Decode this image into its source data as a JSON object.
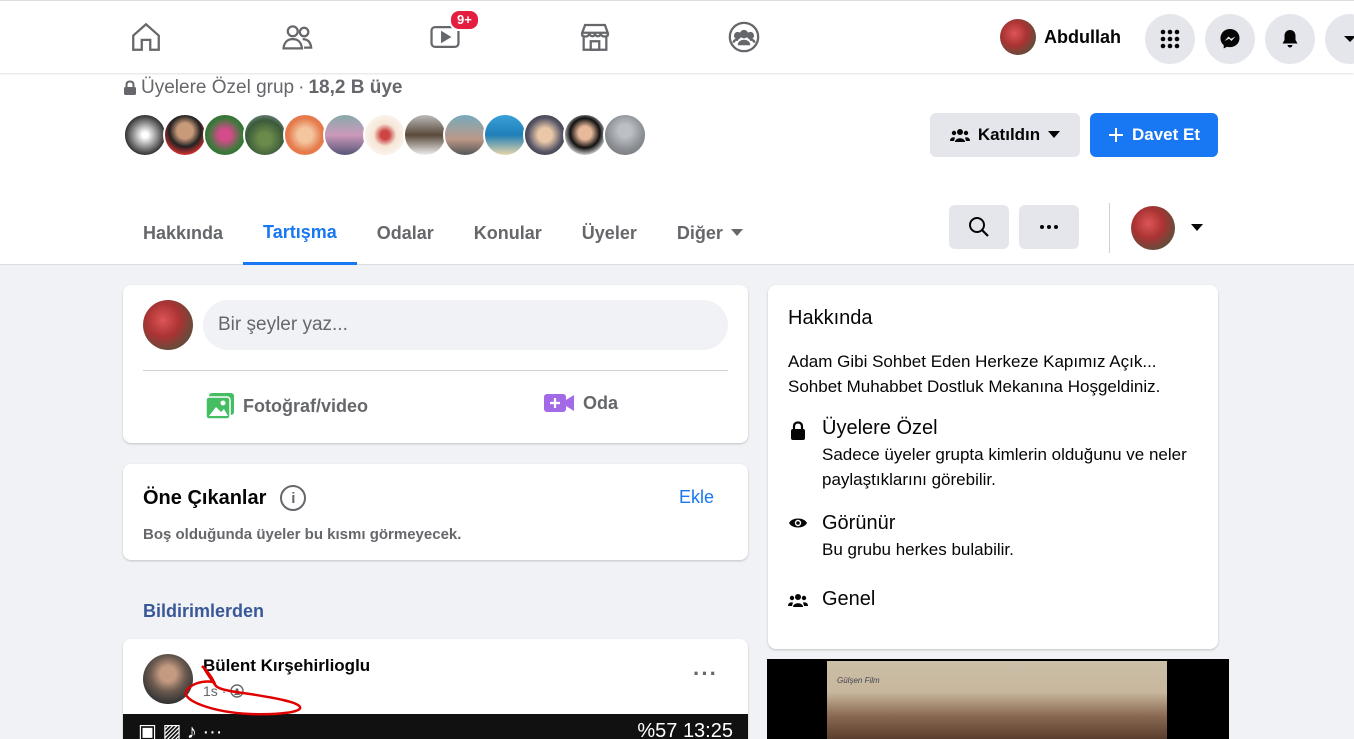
{
  "topbar": {
    "nav": [
      {
        "name": "home"
      },
      {
        "name": "friends"
      },
      {
        "name": "watch",
        "badge": "9+"
      },
      {
        "name": "marketplace"
      },
      {
        "name": "groups"
      }
    ],
    "profile_name": "Abdullah"
  },
  "group": {
    "privacy": "Üyelere Özel grup",
    "separator": "·",
    "member_count": "18,2 B üye",
    "joined_label": "Katıldın",
    "invite_label": "Davet Et",
    "tabs": [
      "Hakkında",
      "Tartışma",
      "Odalar",
      "Konular",
      "Üyeler",
      "Diğer"
    ],
    "active_tab": "Tartışma"
  },
  "composer": {
    "placeholder": "Bir şeyler yaz...",
    "photo_label": "Fotoğraf/video",
    "room_label": "Oda"
  },
  "featured": {
    "title": "Öne Çıkanlar",
    "add_label": "Ekle",
    "subtitle": "Boş olduğunda üyeler bu kısmı görmeyecek."
  },
  "feed": {
    "section_label": "Bildirimlerden",
    "post": {
      "author": "Bülent Kırşehirlioglu",
      "time": "1s",
      "dot": "·",
      "media_status": "%57",
      "media_clock": "13:25"
    }
  },
  "about": {
    "title": "Hakkında",
    "description": "Adam Gibi Sohbet Eden Herkeze Kapımız Açık... Sohbet Muhabbet Dostluk Mekanına Hoşgeldiniz.",
    "items": [
      {
        "icon": "lock-icon",
        "title": "Üyelere Özel",
        "desc": "Sadece üyeler grupta kimlerin olduğunu ve neler paylaştıklarını görebilir."
      },
      {
        "icon": "eye-icon",
        "title": "Görünür",
        "desc": "Bu grubu herkes bulabilir."
      },
      {
        "icon": "people-icon",
        "title": "Genel",
        "desc": ""
      }
    ]
  },
  "video": {
    "logo_text": "Gülşen Film"
  },
  "colors": {
    "accent": "#1877f2",
    "badge": "#e41e3f",
    "page_bg": "#f0f2f5"
  }
}
